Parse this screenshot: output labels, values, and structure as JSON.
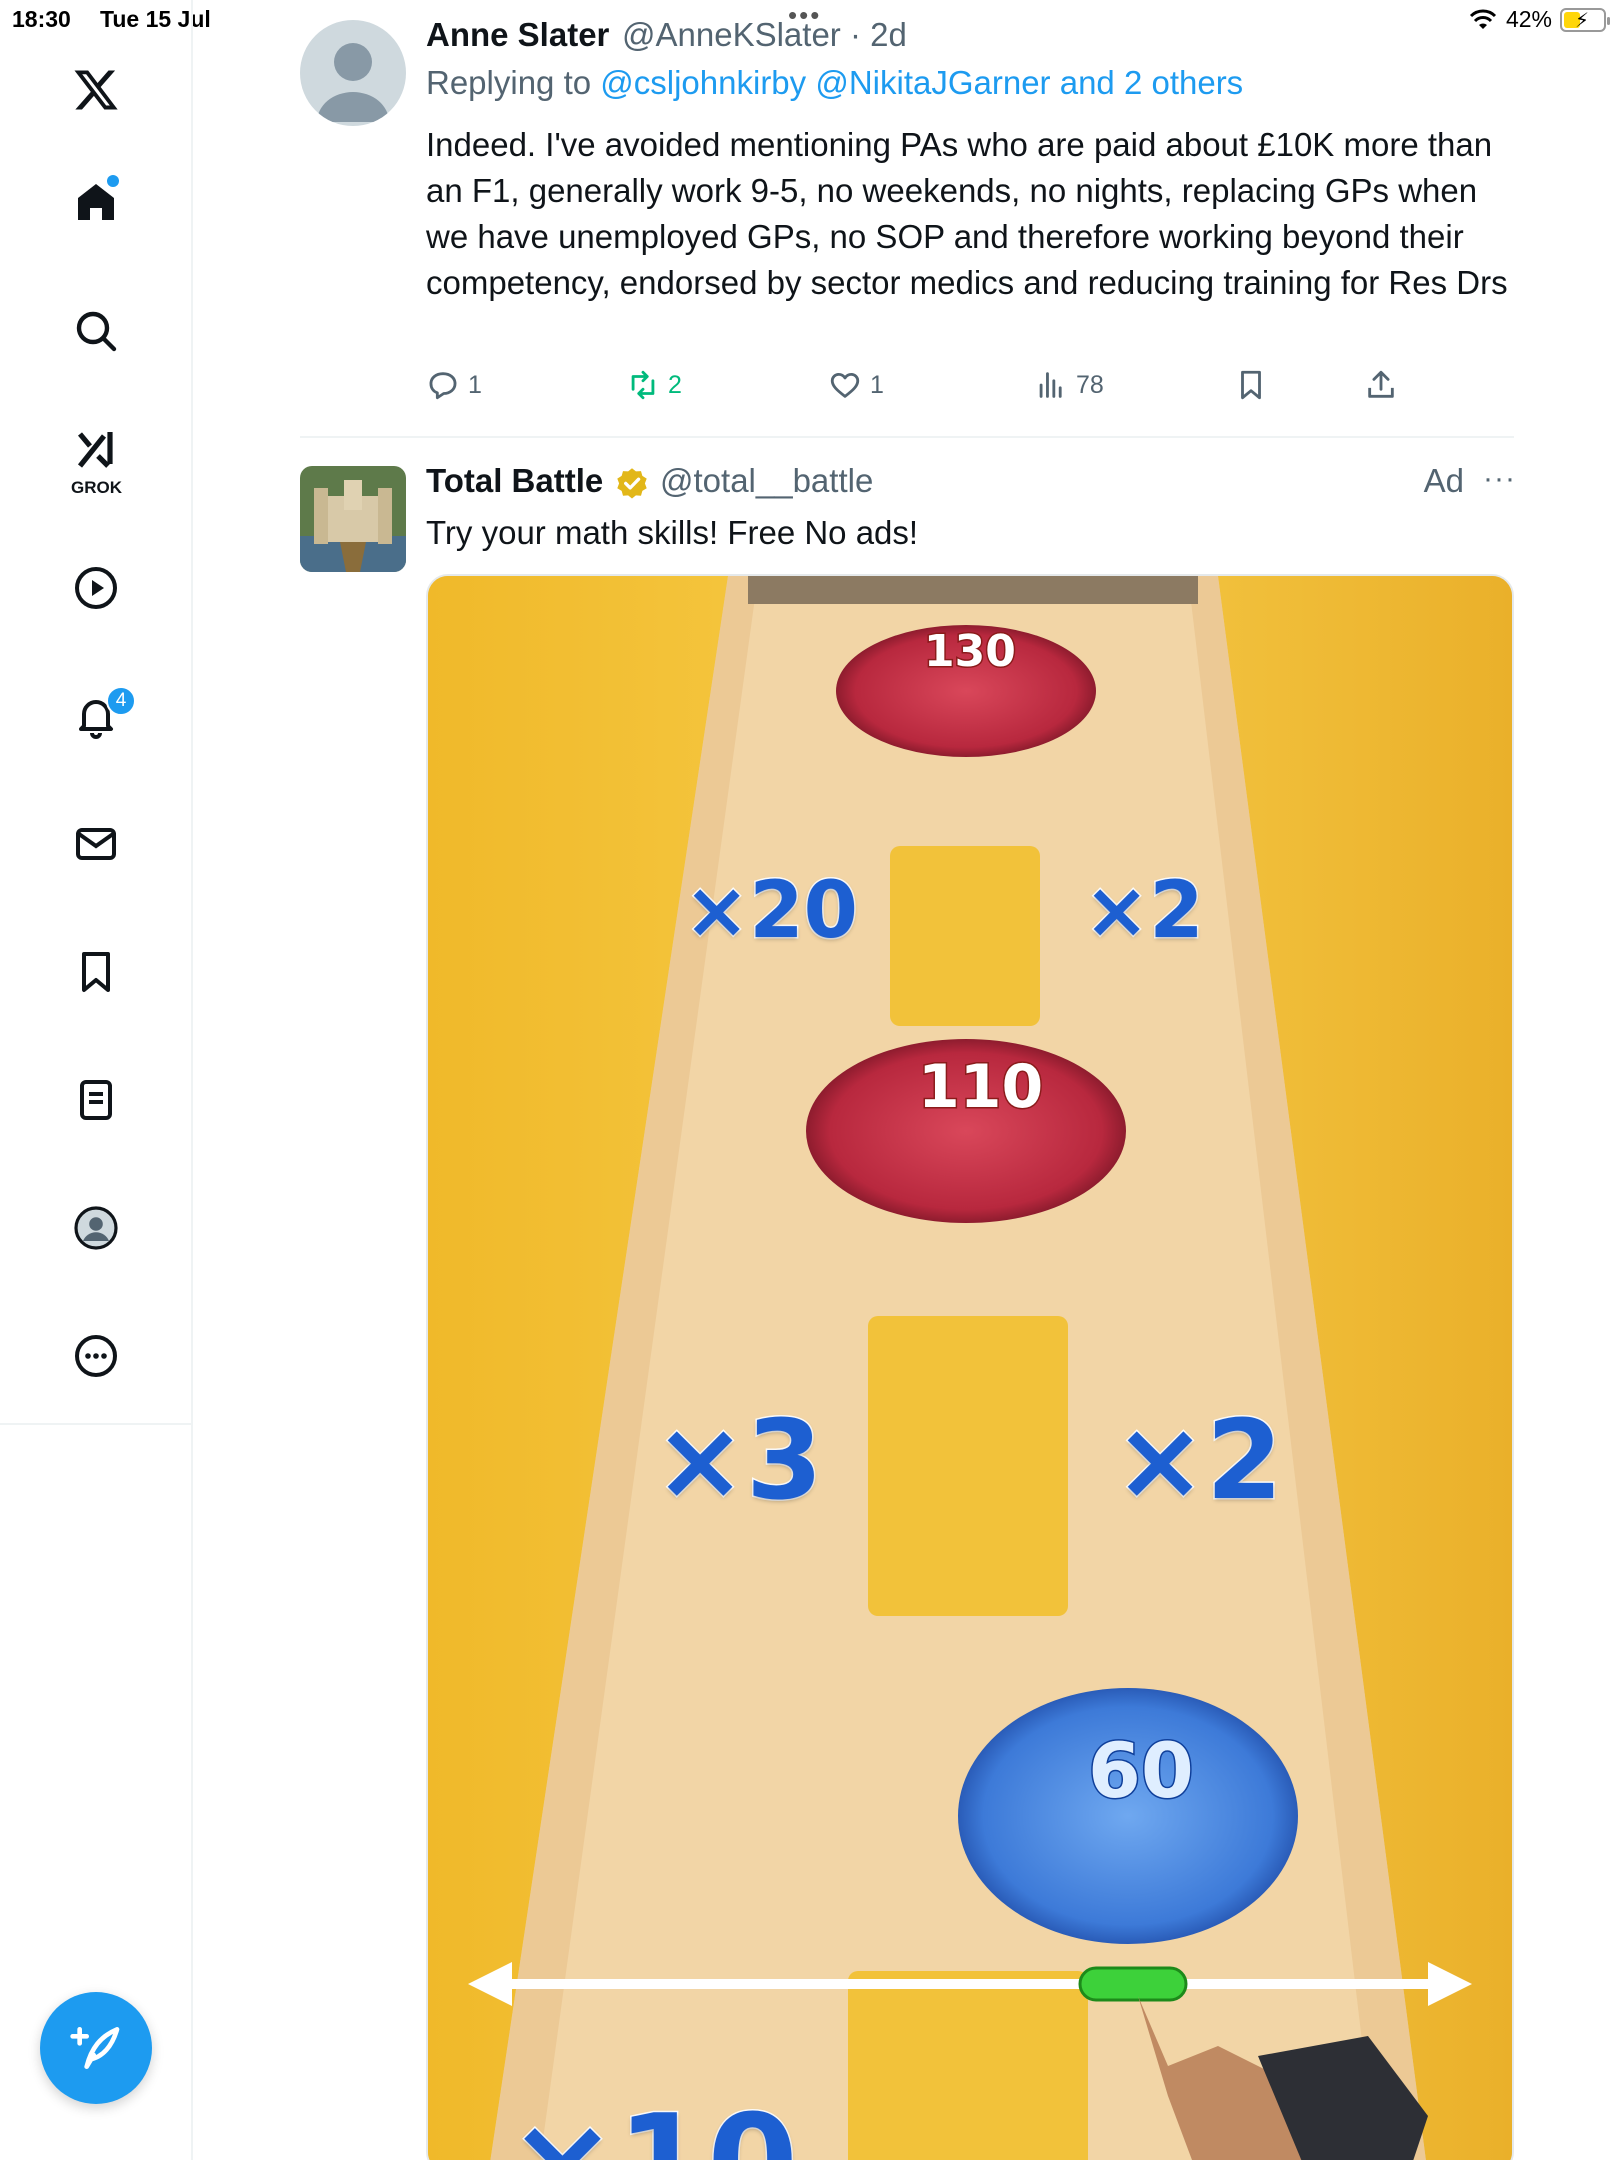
{
  "status_bar": {
    "time": "18:30",
    "date": "Tue 15 Jul",
    "battery": "42%",
    "battery_level": 0.42
  },
  "sidebar": {
    "items": [
      {
        "label": "",
        "icon": "x-logo-icon"
      },
      {
        "label": "",
        "icon": "home-icon"
      },
      {
        "label": "",
        "icon": "search-icon"
      },
      {
        "label": "GROK",
        "icon": "grok-icon"
      },
      {
        "label": "",
        "icon": "video-icon"
      },
      {
        "label": "",
        "icon": "bell-icon"
      },
      {
        "label": "",
        "icon": "mail-icon"
      },
      {
        "label": "",
        "icon": "bookmark-icon"
      },
      {
        "label": "",
        "icon": "lists-icon"
      },
      {
        "label": "",
        "icon": "profile-icon"
      },
      {
        "label": "",
        "icon": "more-icon"
      }
    ],
    "notification_count": "4",
    "compose_icon": "compose-icon"
  },
  "reply_tweet": {
    "name": "Anne Slater",
    "handle": "@AnneKSlater",
    "time": "· 2d",
    "replying_prefix": "Replying to ",
    "replying_to": "@csljohnkirby @NikitaJGarner and 2 others",
    "text": "Indeed. I've avoided mentioning PAs who are paid about £10K more than an F1, generally work 9-5, no weekends, no nights, replacing GPs when we have unemployed GPs, no SOP and therefore working beyond their competency, endorsed by sector medics and reducing training for Res Drs",
    "actions": {
      "replies": "1",
      "reposts": "2",
      "likes": "1",
      "views": "78"
    }
  },
  "ad_tweet": {
    "name": "Total Battle",
    "handle": "@total__battle",
    "ad_label": "Ad",
    "more": "···",
    "text": "Try your math skills! Free No ads!",
    "media": {
      "enemy_top": "130",
      "gate_left_1": "×20",
      "gate_right_1": "×2",
      "enemy_mid": "110",
      "gate_left_2": "×3",
      "gate_right_2": "×2",
      "player_count": "60",
      "gate_bottom": "×10"
    }
  },
  "colors": {
    "accent": "#1d9bf0",
    "repost_green": "#00ba7c",
    "text_secondary": "#536471"
  }
}
